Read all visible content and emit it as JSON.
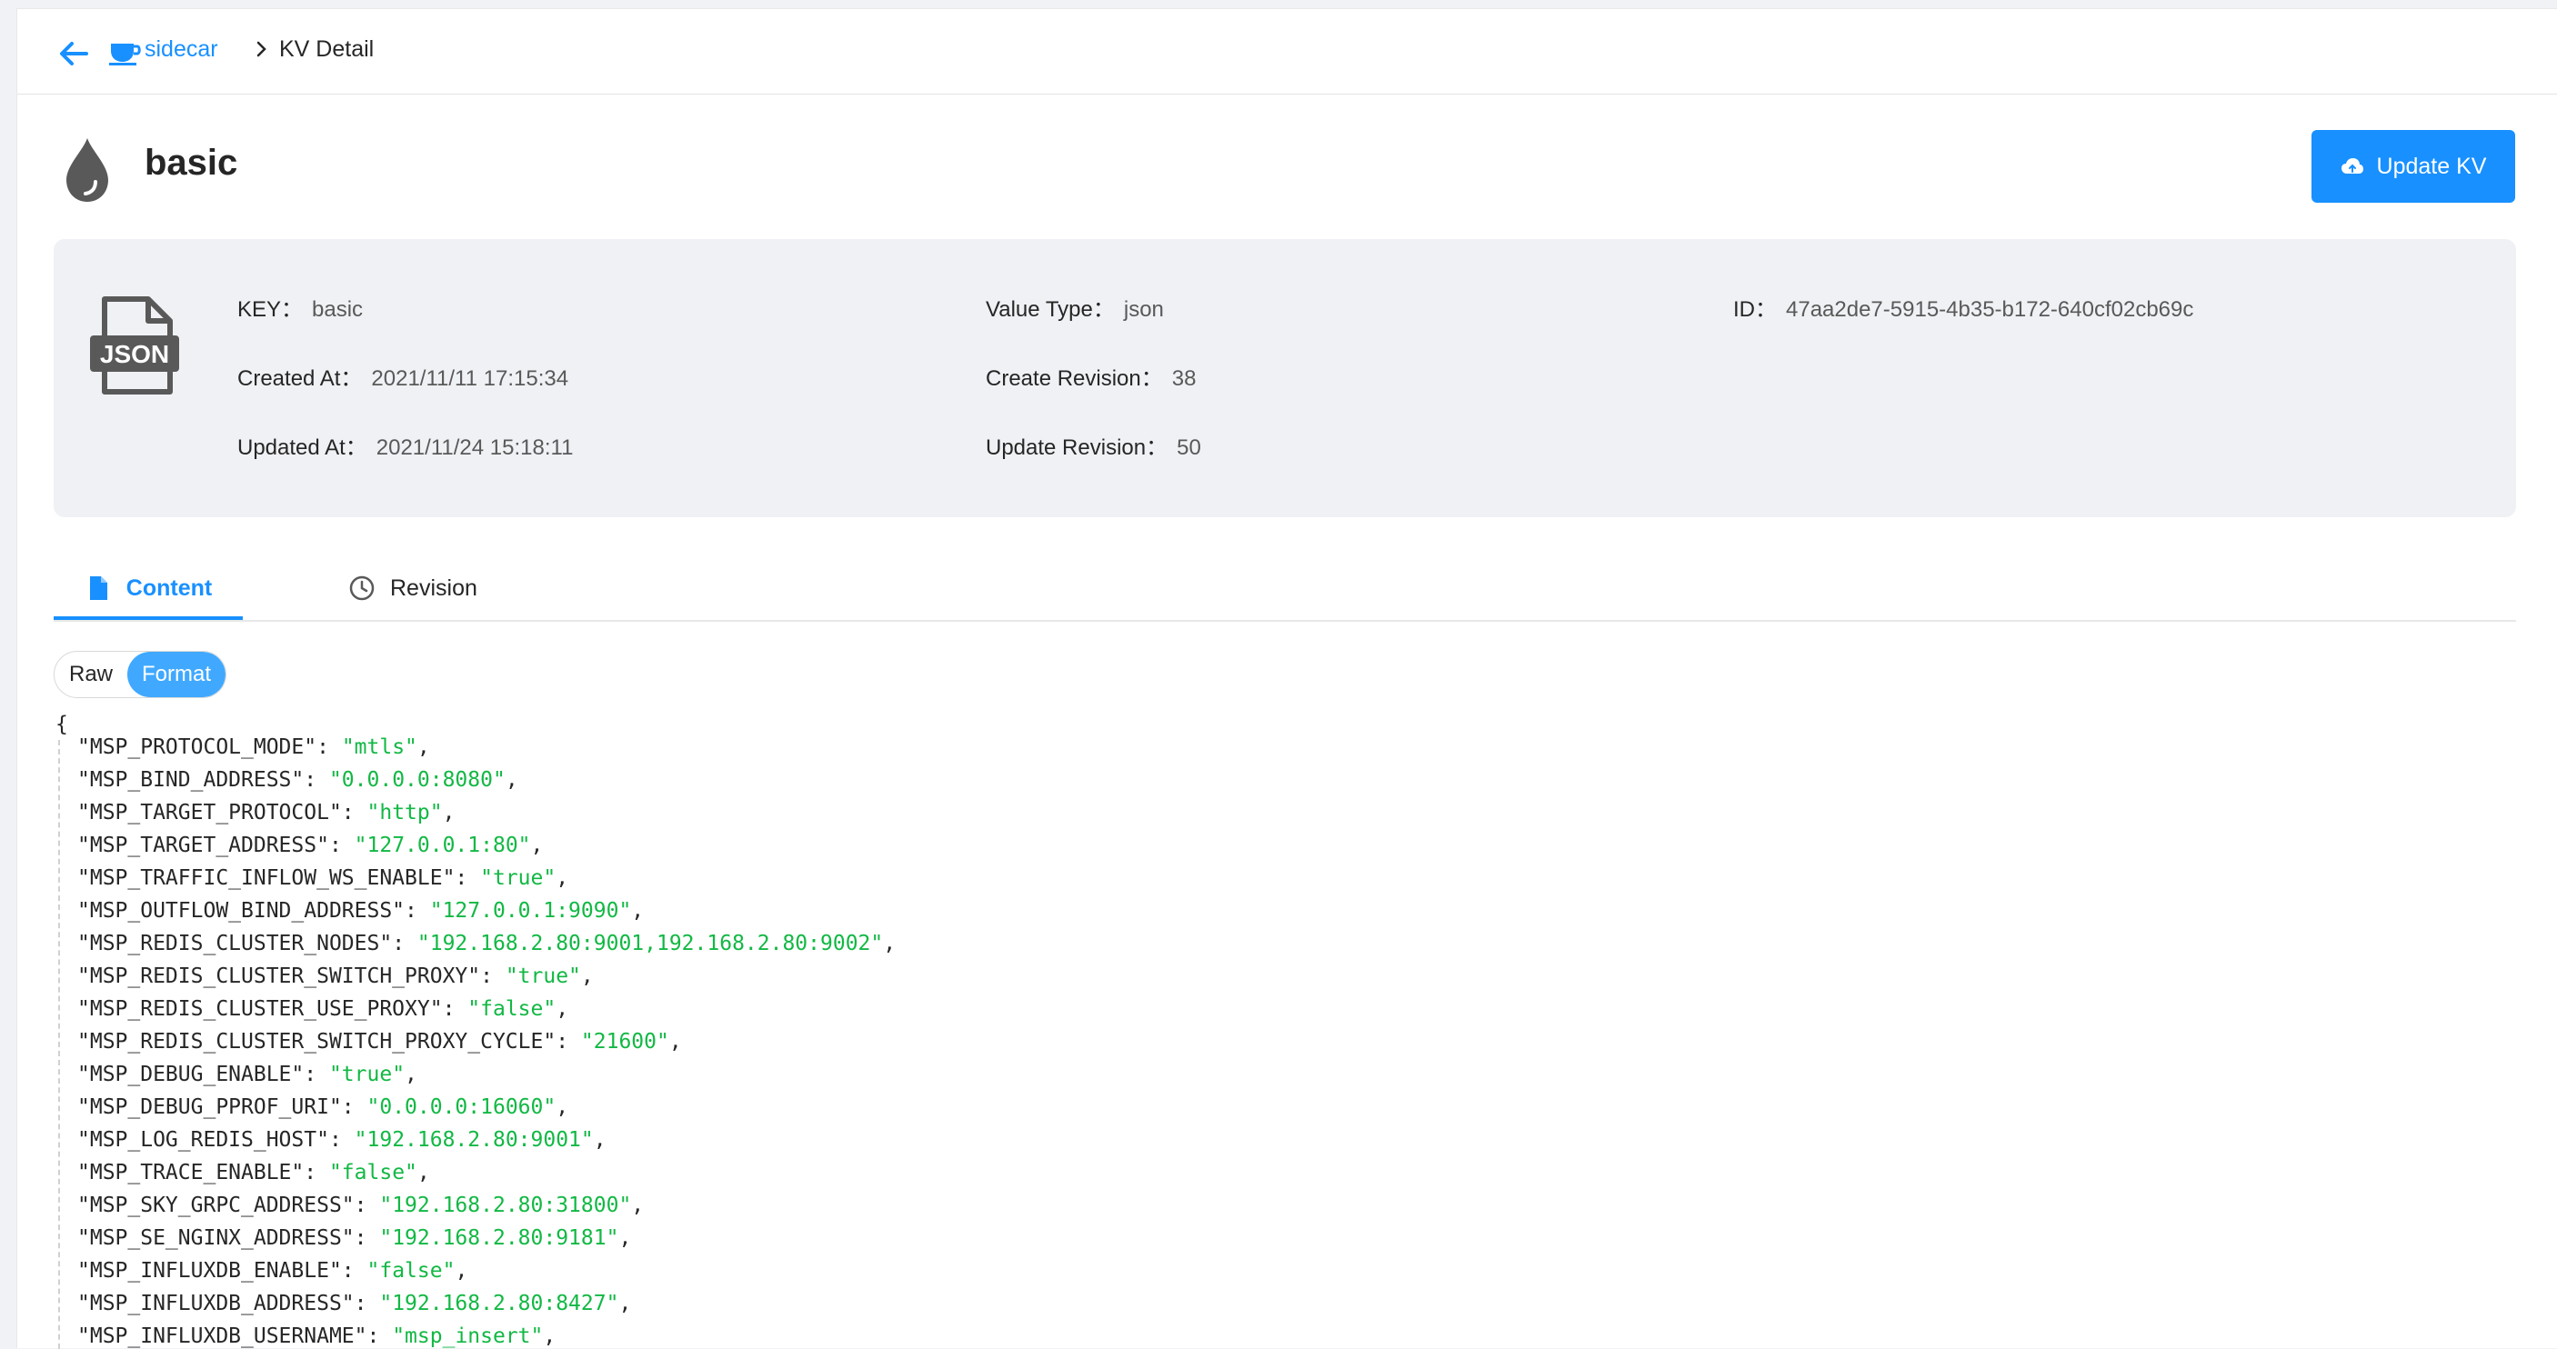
{
  "breadcrumb": {
    "app_link": "sidecar",
    "current": "KV Detail"
  },
  "header": {
    "title": "basic",
    "update_button": "Update KV"
  },
  "info": {
    "file_type_badge": "JSON",
    "key_label": "KEY：",
    "key_value": "basic",
    "created_label": "Created At：",
    "created_value": "2021/11/11 17:15:34",
    "updated_label": "Updated At：",
    "updated_value": "2021/11/24 15:18:11",
    "value_type_label": "Value Type：",
    "value_type_value": "json",
    "create_rev_label": "Create Revision：",
    "create_rev_value": "38",
    "update_rev_label": "Update Revision：",
    "update_rev_value": "50",
    "id_label": "ID：",
    "id_value": "47aa2de7-5915-4b35-b172-640cf02cb69c"
  },
  "tabs": [
    {
      "label": "Content",
      "active": true
    },
    {
      "label": "Revision",
      "active": false
    }
  ],
  "view_mode": {
    "raw": "Raw",
    "format": "Format",
    "selected": "Format"
  },
  "code": {
    "open_brace": "{",
    "entries": [
      {
        "key": "\"MSP_PROTOCOL_MODE\"",
        "value": "\"mtls\""
      },
      {
        "key": "\"MSP_BIND_ADDRESS\"",
        "value": "\"0.0.0.0:8080\""
      },
      {
        "key": "\"MSP_TARGET_PROTOCOL\"",
        "value": "\"http\""
      },
      {
        "key": "\"MSP_TARGET_ADDRESS\"",
        "value": "\"127.0.0.1:80\""
      },
      {
        "key": "\"MSP_TRAFFIC_INFLOW_WS_ENABLE\"",
        "value": "\"true\""
      },
      {
        "key": "\"MSP_OUTFLOW_BIND_ADDRESS\"",
        "value": "\"127.0.0.1:9090\""
      },
      {
        "key": "\"MSP_REDIS_CLUSTER_NODES\"",
        "value": "\"192.168.2.80:9001,192.168.2.80:9002\""
      },
      {
        "key": "\"MSP_REDIS_CLUSTER_SWITCH_PROXY\"",
        "value": "\"true\""
      },
      {
        "key": "\"MSP_REDIS_CLUSTER_USE_PROXY\"",
        "value": "\"false\""
      },
      {
        "key": "\"MSP_REDIS_CLUSTER_SWITCH_PROXY_CYCLE\"",
        "value": "\"21600\""
      },
      {
        "key": "\"MSP_DEBUG_ENABLE\"",
        "value": "\"true\""
      },
      {
        "key": "\"MSP_DEBUG_PPROF_URI\"",
        "value": "\"0.0.0.0:16060\""
      },
      {
        "key": "\"MSP_LOG_REDIS_HOST\"",
        "value": "\"192.168.2.80:9001\""
      },
      {
        "key": "\"MSP_TRACE_ENABLE\"",
        "value": "\"false\""
      },
      {
        "key": "\"MSP_SKY_GRPC_ADDRESS\"",
        "value": "\"192.168.2.80:31800\""
      },
      {
        "key": "\"MSP_SE_NGINX_ADDRESS\"",
        "value": "\"192.168.2.80:9181\""
      },
      {
        "key": "\"MSP_INFLUXDB_ENABLE\"",
        "value": "\"false\""
      },
      {
        "key": "\"MSP_INFLUXDB_ADDRESS\"",
        "value": "\"192.168.2.80:8427\""
      },
      {
        "key": "\"MSP_INFLUXDB_USERNAME\"",
        "value": "\"msp_insert\""
      }
    ]
  },
  "colors": {
    "primary": "#1890ff",
    "string": "#12b844",
    "panel_bg": "#f0f1f4"
  }
}
